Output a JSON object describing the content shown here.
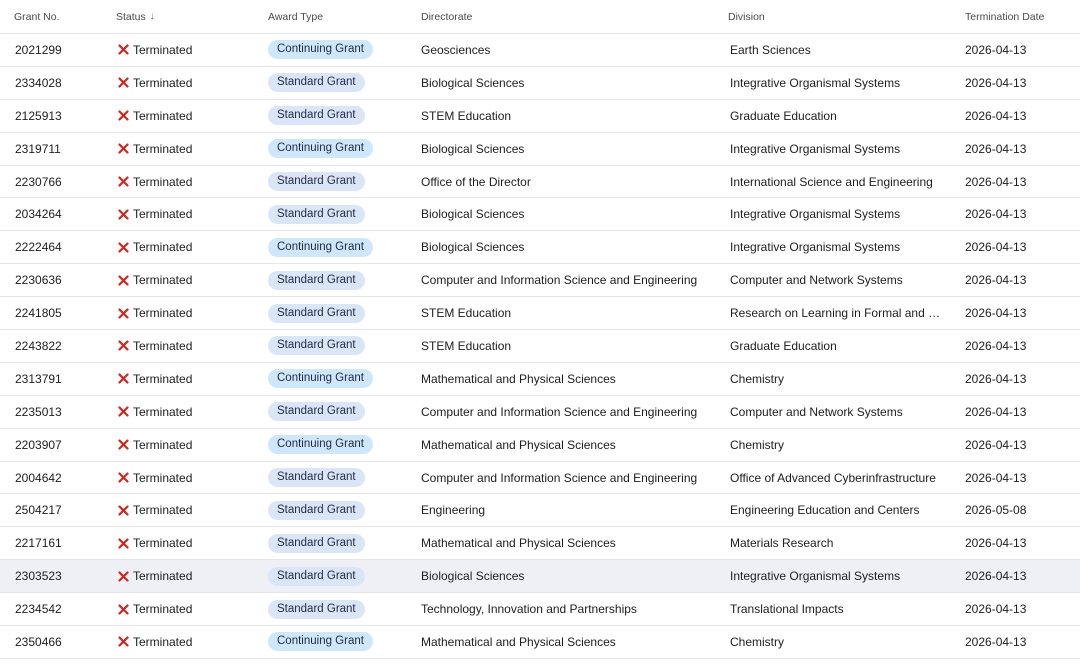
{
  "colors": {
    "terminated_x": "#d0261d",
    "standard_pill": "#dbe5f8",
    "continuing_pill": "#cfe7fb",
    "highlight_row": "#eef0f6"
  },
  "header": {
    "grant_no": "Grant No.",
    "status": "Status",
    "status_sort_icon": "arrow-down-icon",
    "status_sort_glyph": "↓",
    "award_type": "Award Type",
    "directorate": "Directorate",
    "division": "Division",
    "termination_date": "Termination Date"
  },
  "rows": [
    {
      "grant": "2021299",
      "status": "Terminated",
      "award": "Continuing Grant",
      "directorate": "Geosciences",
      "division": "Earth Sciences",
      "date": "2026-04-13"
    },
    {
      "grant": "2334028",
      "status": "Terminated",
      "award": "Standard Grant",
      "directorate": "Biological Sciences",
      "division": "Integrative Organismal Systems",
      "date": "2026-04-13"
    },
    {
      "grant": "2125913",
      "status": "Terminated",
      "award": "Standard Grant",
      "directorate": "STEM Education",
      "division": "Graduate Education",
      "date": "2026-04-13"
    },
    {
      "grant": "2319711",
      "status": "Terminated",
      "award": "Continuing Grant",
      "directorate": "Biological Sciences",
      "division": "Integrative Organismal Systems",
      "date": "2026-04-13"
    },
    {
      "grant": "2230766",
      "status": "Terminated",
      "award": "Standard Grant",
      "directorate": "Office of the Director",
      "division": "International Science and Engineering",
      "date": "2026-04-13"
    },
    {
      "grant": "2034264",
      "status": "Terminated",
      "award": "Standard Grant",
      "directorate": "Biological Sciences",
      "division": "Integrative Organismal Systems",
      "date": "2026-04-13"
    },
    {
      "grant": "2222464",
      "status": "Terminated",
      "award": "Continuing Grant",
      "directorate": "Biological Sciences",
      "division": "Integrative Organismal Systems",
      "date": "2026-04-13"
    },
    {
      "grant": "2230636",
      "status": "Terminated",
      "award": "Standard Grant",
      "directorate": "Computer and Information Science and Engineering",
      "division": "Computer and Network Systems",
      "date": "2026-04-13"
    },
    {
      "grant": "2241805",
      "status": "Terminated",
      "award": "Standard Grant",
      "directorate": "STEM Education",
      "division": "Research on Learning in Formal and Infor…",
      "date": "2026-04-13"
    },
    {
      "grant": "2243822",
      "status": "Terminated",
      "award": "Standard Grant",
      "directorate": "STEM Education",
      "division": "Graduate Education",
      "date": "2026-04-13"
    },
    {
      "grant": "2313791",
      "status": "Terminated",
      "award": "Continuing Grant",
      "directorate": "Mathematical and Physical Sciences",
      "division": "Chemistry",
      "date": "2026-04-13"
    },
    {
      "grant": "2235013",
      "status": "Terminated",
      "award": "Standard Grant",
      "directorate": "Computer and Information Science and Engineering",
      "division": "Computer and Network Systems",
      "date": "2026-04-13"
    },
    {
      "grant": "2203907",
      "status": "Terminated",
      "award": "Continuing Grant",
      "directorate": "Mathematical and Physical Sciences",
      "division": "Chemistry",
      "date": "2026-04-13"
    },
    {
      "grant": "2004642",
      "status": "Terminated",
      "award": "Standard Grant",
      "directorate": "Computer and Information Science and Engineering",
      "division": "Office of Advanced Cyberinfrastructure",
      "date": "2026-04-13"
    },
    {
      "grant": "2504217",
      "status": "Terminated",
      "award": "Standard Grant",
      "directorate": "Engineering",
      "division": "Engineering Education and Centers",
      "date": "2026-05-08"
    },
    {
      "grant": "2217161",
      "status": "Terminated",
      "award": "Standard Grant",
      "directorate": "Mathematical and Physical Sciences",
      "division": "Materials Research",
      "date": "2026-04-13"
    },
    {
      "grant": "2303523",
      "status": "Terminated",
      "award": "Standard Grant",
      "directorate": "Biological Sciences",
      "division": "Integrative Organismal Systems",
      "date": "2026-04-13",
      "highlighted": true
    },
    {
      "grant": "2234542",
      "status": "Terminated",
      "award": "Standard Grant",
      "directorate": "Technology, Innovation and Partnerships",
      "division": "Translational Impacts",
      "date": "2026-04-13"
    },
    {
      "grant": "2350466",
      "status": "Terminated",
      "award": "Continuing Grant",
      "directorate": "Mathematical and Physical Sciences",
      "division": "Chemistry",
      "date": "2026-04-13"
    }
  ]
}
